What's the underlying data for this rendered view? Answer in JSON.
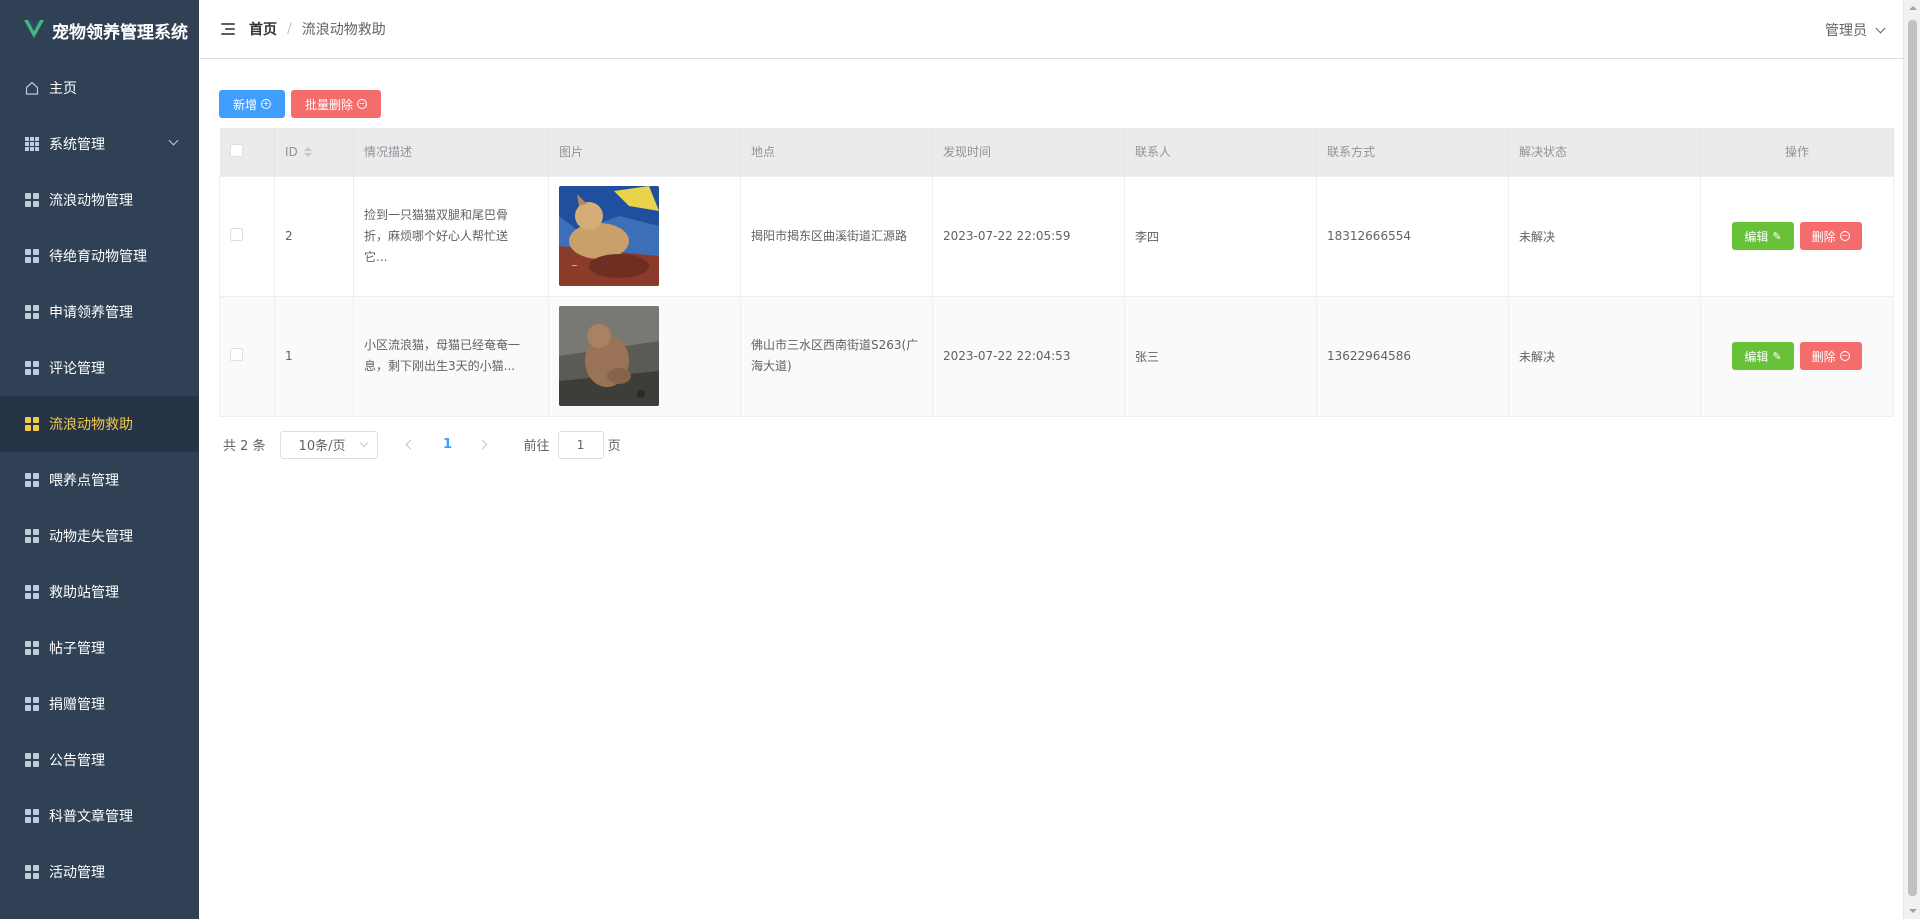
{
  "app": {
    "title": "宠物领养管理系统"
  },
  "sidebar": {
    "items": [
      {
        "label": "主页",
        "icon": "home-icon"
      },
      {
        "label": "系统管理",
        "icon": "grid-icon",
        "has_submenu": true
      },
      {
        "label": "流浪动物管理",
        "icon": "grid-icon"
      },
      {
        "label": "待绝育动物管理",
        "icon": "grid-icon"
      },
      {
        "label": "申请领养管理",
        "icon": "grid-icon"
      },
      {
        "label": "评论管理",
        "icon": "grid-icon"
      },
      {
        "label": "流浪动物救助",
        "icon": "grid-icon",
        "active": true
      },
      {
        "label": "喂养点管理",
        "icon": "grid-icon"
      },
      {
        "label": "动物走失管理",
        "icon": "grid-icon"
      },
      {
        "label": "救助站管理",
        "icon": "grid-icon"
      },
      {
        "label": "帖子管理",
        "icon": "grid-icon"
      },
      {
        "label": "捐赠管理",
        "icon": "grid-icon"
      },
      {
        "label": "公告管理",
        "icon": "grid-icon"
      },
      {
        "label": "科普文章管理",
        "icon": "grid-icon"
      },
      {
        "label": "活动管理",
        "icon": "grid-icon"
      }
    ]
  },
  "header": {
    "breadcrumb_home": "首页",
    "breadcrumb_sep": "/",
    "breadcrumb_current": "流浪动物救助",
    "user": "管理员"
  },
  "toolbar": {
    "add_label": "新增",
    "batch_delete_label": "批量删除"
  },
  "table": {
    "columns": [
      "ID",
      "情况描述",
      "图片",
      "地点",
      "发现时间",
      "联系人",
      "联系方式",
      "解决状态",
      "操作"
    ],
    "rows": [
      {
        "id": "2",
        "desc": "捡到一只猫猫双腿和尾巴骨折，麻烦哪个好心人帮忙送它...",
        "location": "揭阳市揭东区曲溪街道汇源路",
        "time": "2023-07-22 22:05:59",
        "contact": "李四",
        "phone": "18312666554",
        "status": "未解决"
      },
      {
        "id": "1",
        "desc": "小区流浪猫，母猫已经奄奄一息，剩下刚出生3天的小猫...",
        "location": "佛山市三水区西南街道S263(广海大道)",
        "time": "2023-07-22 22:04:53",
        "contact": "张三",
        "phone": "13622964586",
        "status": "未解决"
      }
    ],
    "edit_label": "编辑",
    "delete_label": "删除"
  },
  "pagination": {
    "total_text": "共 2 条",
    "page_size": "10条/页",
    "current_page": "1",
    "goto_prefix": "前往",
    "goto_value": "1",
    "goto_suffix": "页"
  },
  "colors": {
    "sidebar_bg": "#304156",
    "active_text": "#f2c94c",
    "primary": "#409eff",
    "danger": "#f56c6c",
    "success": "#67c23a"
  }
}
